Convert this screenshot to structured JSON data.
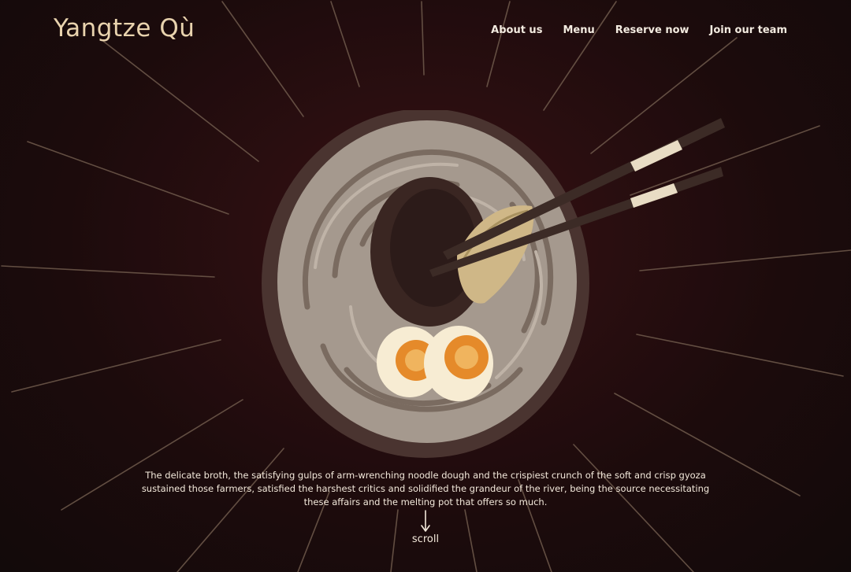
{
  "brand": {
    "name": "Yangtze Qù"
  },
  "nav": {
    "items": [
      {
        "label": "About us"
      },
      {
        "label": "Menu"
      },
      {
        "label": "Reserve now"
      },
      {
        "label": "Join our team"
      }
    ]
  },
  "hero": {
    "illustration": "noodle-bowl-with-chopsticks-gyoza-and-eggs",
    "tagline": "The delicate broth, the satisfying gulps of arm-wrenching noodle dough and the crispiest crunch of the soft and crisp gyoza sustained those farmers, satisfied the harshest critics and solidified the grandeur of the river, being the source necessitating these affairs and the melting pot that offers so much.",
    "scroll_label": "scroll",
    "scroll_icon": "arrow-down-icon"
  },
  "colors": {
    "background": "#1c0b0c",
    "background_center": "#3a1114",
    "logo": "#e9d3ae",
    "text": "#f3ebe0",
    "rays": "#6f5a4c",
    "bowl": "#a5998e",
    "bowl_rim": "#4a3430",
    "chopsticks": "#3c2b26",
    "chopstick_band": "#e8dcc4",
    "gyoza": "#cfb787",
    "egg_white": "#f7ecd3",
    "egg_yolk": "#e58a2a"
  }
}
